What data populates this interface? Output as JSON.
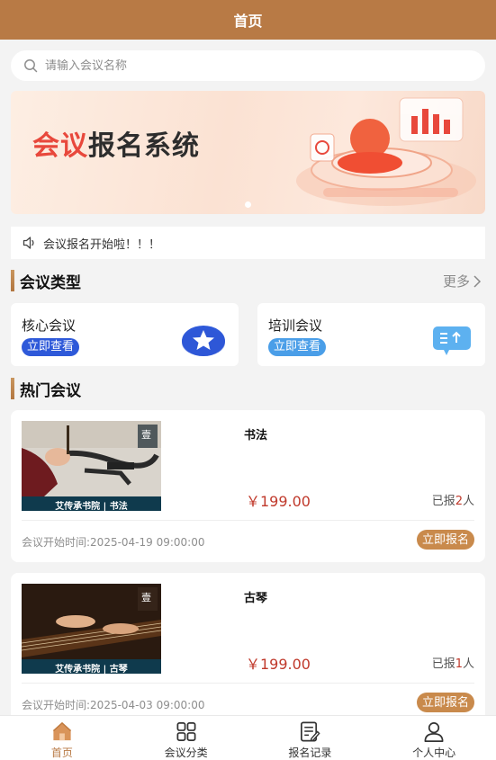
{
  "header": {
    "title": "首页"
  },
  "search": {
    "placeholder": "请输入会议名称",
    "icon": "search-icon"
  },
  "banner": {
    "title_red": "会议",
    "title_dark": "报名系统"
  },
  "notice": {
    "text": "会议报名开始啦！！！",
    "icon": "speaker-icon"
  },
  "categories": {
    "title": "会议类型",
    "more": "更多",
    "items": [
      {
        "name": "核心会议",
        "button": "立即查看",
        "button_color": "#2e59d9",
        "icon": "star-icon"
      },
      {
        "name": "培训会议",
        "button": "立即查看",
        "button_color": "#4a9ee8",
        "icon": "chat-bubble-icon"
      }
    ]
  },
  "hot": {
    "title": "热门会议",
    "items": [
      {
        "name": "书法",
        "price": "￥199.00",
        "count_prefix": "已报",
        "count": "2",
        "count_suffix": "人",
        "time": "会议开始时间:2025-04-19 09:00:00",
        "button": "立即报名",
        "caption": "艾传承书院 | 书法",
        "logo_char": "壹",
        "logo_sub": "艾传承书院"
      },
      {
        "name": "古琴",
        "price": "￥199.00",
        "count_prefix": "已报",
        "count": "1",
        "count_suffix": "人",
        "time": "会议开始时间:2025-04-03 09:00:00",
        "button": "立即报名",
        "caption": "艾传承书院 | 古琴",
        "logo_char": "壹",
        "logo_sub": "艾传承书院"
      }
    ]
  },
  "tabbar": {
    "items": [
      {
        "label": "首页",
        "icon": "home-icon",
        "active": true
      },
      {
        "label": "会议分类",
        "icon": "grid-icon",
        "active": false
      },
      {
        "label": "报名记录",
        "icon": "document-edit-icon",
        "active": false
      },
      {
        "label": "个人中心",
        "icon": "user-icon",
        "active": false
      }
    ]
  },
  "colors": {
    "brand": "#b87a45",
    "price": "#c0392b",
    "button": "#c98a4c"
  }
}
